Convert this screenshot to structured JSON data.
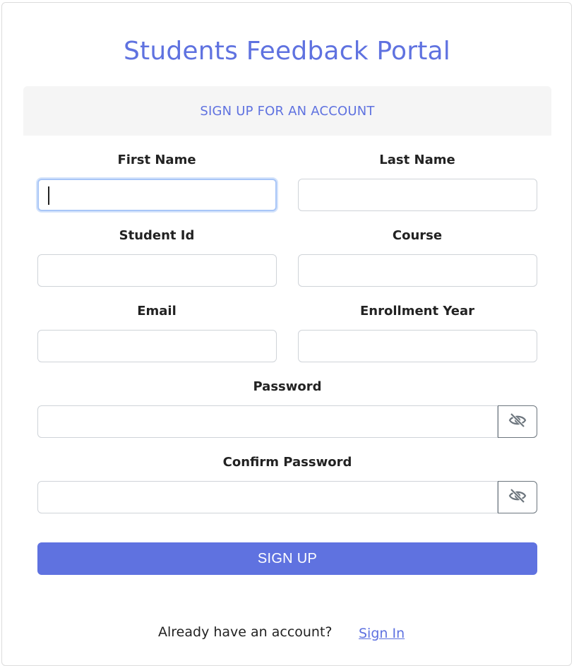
{
  "app": {
    "title": "Students Feedback Portal",
    "subtitle": "SIGN UP FOR AN ACCOUNT"
  },
  "form": {
    "first_name": {
      "label": "First Name",
      "value": ""
    },
    "last_name": {
      "label": "Last Name",
      "value": ""
    },
    "student_id": {
      "label": "Student Id",
      "value": ""
    },
    "course": {
      "label": "Course",
      "value": ""
    },
    "email": {
      "label": "Email",
      "value": ""
    },
    "enrollment_year": {
      "label": "Enrollment Year",
      "value": ""
    },
    "password": {
      "label": "Password",
      "value": "",
      "toggle_icon": "eye-slash-icon"
    },
    "confirm_password": {
      "label": "Confirm Password",
      "value": "",
      "toggle_icon": "eye-slash-icon"
    },
    "submit_label": "SIGN UP"
  },
  "footer": {
    "prompt": "Already have an account?",
    "link_label": "Sign In"
  },
  "colors": {
    "accent": "#5f72e0",
    "panel_bg": "#f5f5f5",
    "input_border": "#cfd3d8",
    "focus_ring": "#a9c6f7",
    "text": "#222222"
  }
}
